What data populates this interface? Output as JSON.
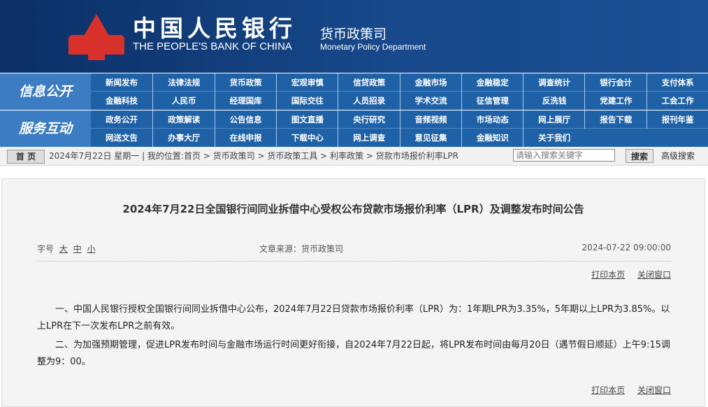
{
  "header": {
    "bank_name_cn": "中国人民银行",
    "bank_name_en": "THE PEOPLE'S BANK OF CHINA",
    "dept_cn": "货币政策司",
    "dept_en": "Monetary Policy Department"
  },
  "nav": {
    "groups": [
      {
        "label": "信息公开",
        "row1": [
          "新闻发布",
          "法律法规",
          "货币政策",
          "宏观审慎",
          "信贷政策",
          "金融市场",
          "金融稳定",
          "调查统计",
          "银行会计",
          "支付体系"
        ],
        "row2": [
          "金融科技",
          "人民币",
          "经理国库",
          "国际交往",
          "人员招录",
          "学术交流",
          "征信管理",
          "反洗钱",
          "党建工作",
          "工会工作"
        ]
      },
      {
        "label": "服务互动",
        "row1": [
          "政务公开",
          "政策解读",
          "公告信息",
          "图文直播",
          "央行研究",
          "音频视频",
          "市场动态",
          "网上展厅",
          "报告下载",
          "报刊年鉴"
        ],
        "row2": [
          "网送文告",
          "办事大厅",
          "在线申报",
          "下载中心",
          "网上调查",
          "意见征集",
          "金融知识",
          "关于我们"
        ]
      }
    ]
  },
  "breadcrumb": {
    "home_label": "首 页",
    "text": "2024年7月22日 星期一 | 我的位置:首页 > 货币政策司 > 货币政策工具 > 利率政策 > 贷款市场报价利率LPR",
    "search_placeholder": "请输入搜索关键字",
    "search_button": "搜索",
    "advanced_search": "高级搜索"
  },
  "article": {
    "title": "2024年7月22日全国银行间同业拆借中心受权公布贷款市场报价利率（LPR）及调整发布时间公告",
    "font_size_label": "字号",
    "font_size_options": [
      "大",
      "中",
      "小"
    ],
    "source": "文章来源：货币政策司",
    "date": "2024-07-22 09:00:00",
    "print_label": "打印本页",
    "close_label": "关闭窗口",
    "paragraphs": [
      "一、中国人民银行授权全国银行间同业拆借中心公布，2024年7月22日贷款市场报价利率（LPR）为：1年期LPR为3.35%，5年期以上LPR为3.85%。以上LPR在下一次发布LPR之前有效。",
      "二、为加强预期管理，促进LPR发布时间与金融市场运行时间更好衔接，自2024年7月22日起，将LPR发布时间由每月20日（遇节假日顺延）上午9:15调整为9：00。"
    ]
  },
  "colors": {
    "header_bg": "#17498b",
    "nav_bg": "#1f61a6",
    "nav_label_bg": "#3c7cc3",
    "logo_red": "#d8312b"
  }
}
